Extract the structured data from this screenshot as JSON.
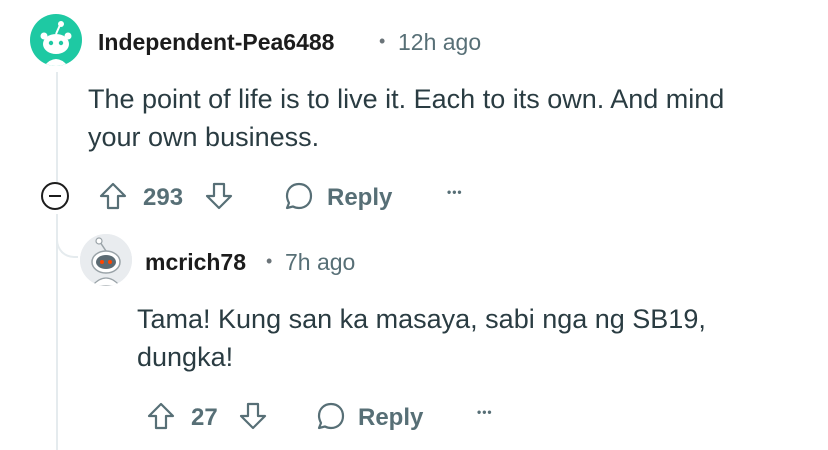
{
  "comment": {
    "username": "Independent-Pea6488",
    "separator": "•",
    "time": "12h ago",
    "body_line1": "The point of life is to live it. Each to its own. And mind",
    "body_line2": "your own business.",
    "votes": "293",
    "reply_label": "Reply",
    "more_label": "•••",
    "avatar_color": "#1ec9a3"
  },
  "reply": {
    "username": "mcrich78",
    "separator": "•",
    "time": "7h ago",
    "body_line1": "Tama! Kung san ka masaya, sabi nga ng SB19,",
    "body_line2": "dungka!",
    "votes": "27",
    "reply_label": "Reply",
    "more_label": "•••"
  },
  "icons": [
    "collapse-icon",
    "upvote-icon",
    "downvote-icon",
    "reply-bubble-icon",
    "more-icon"
  ]
}
